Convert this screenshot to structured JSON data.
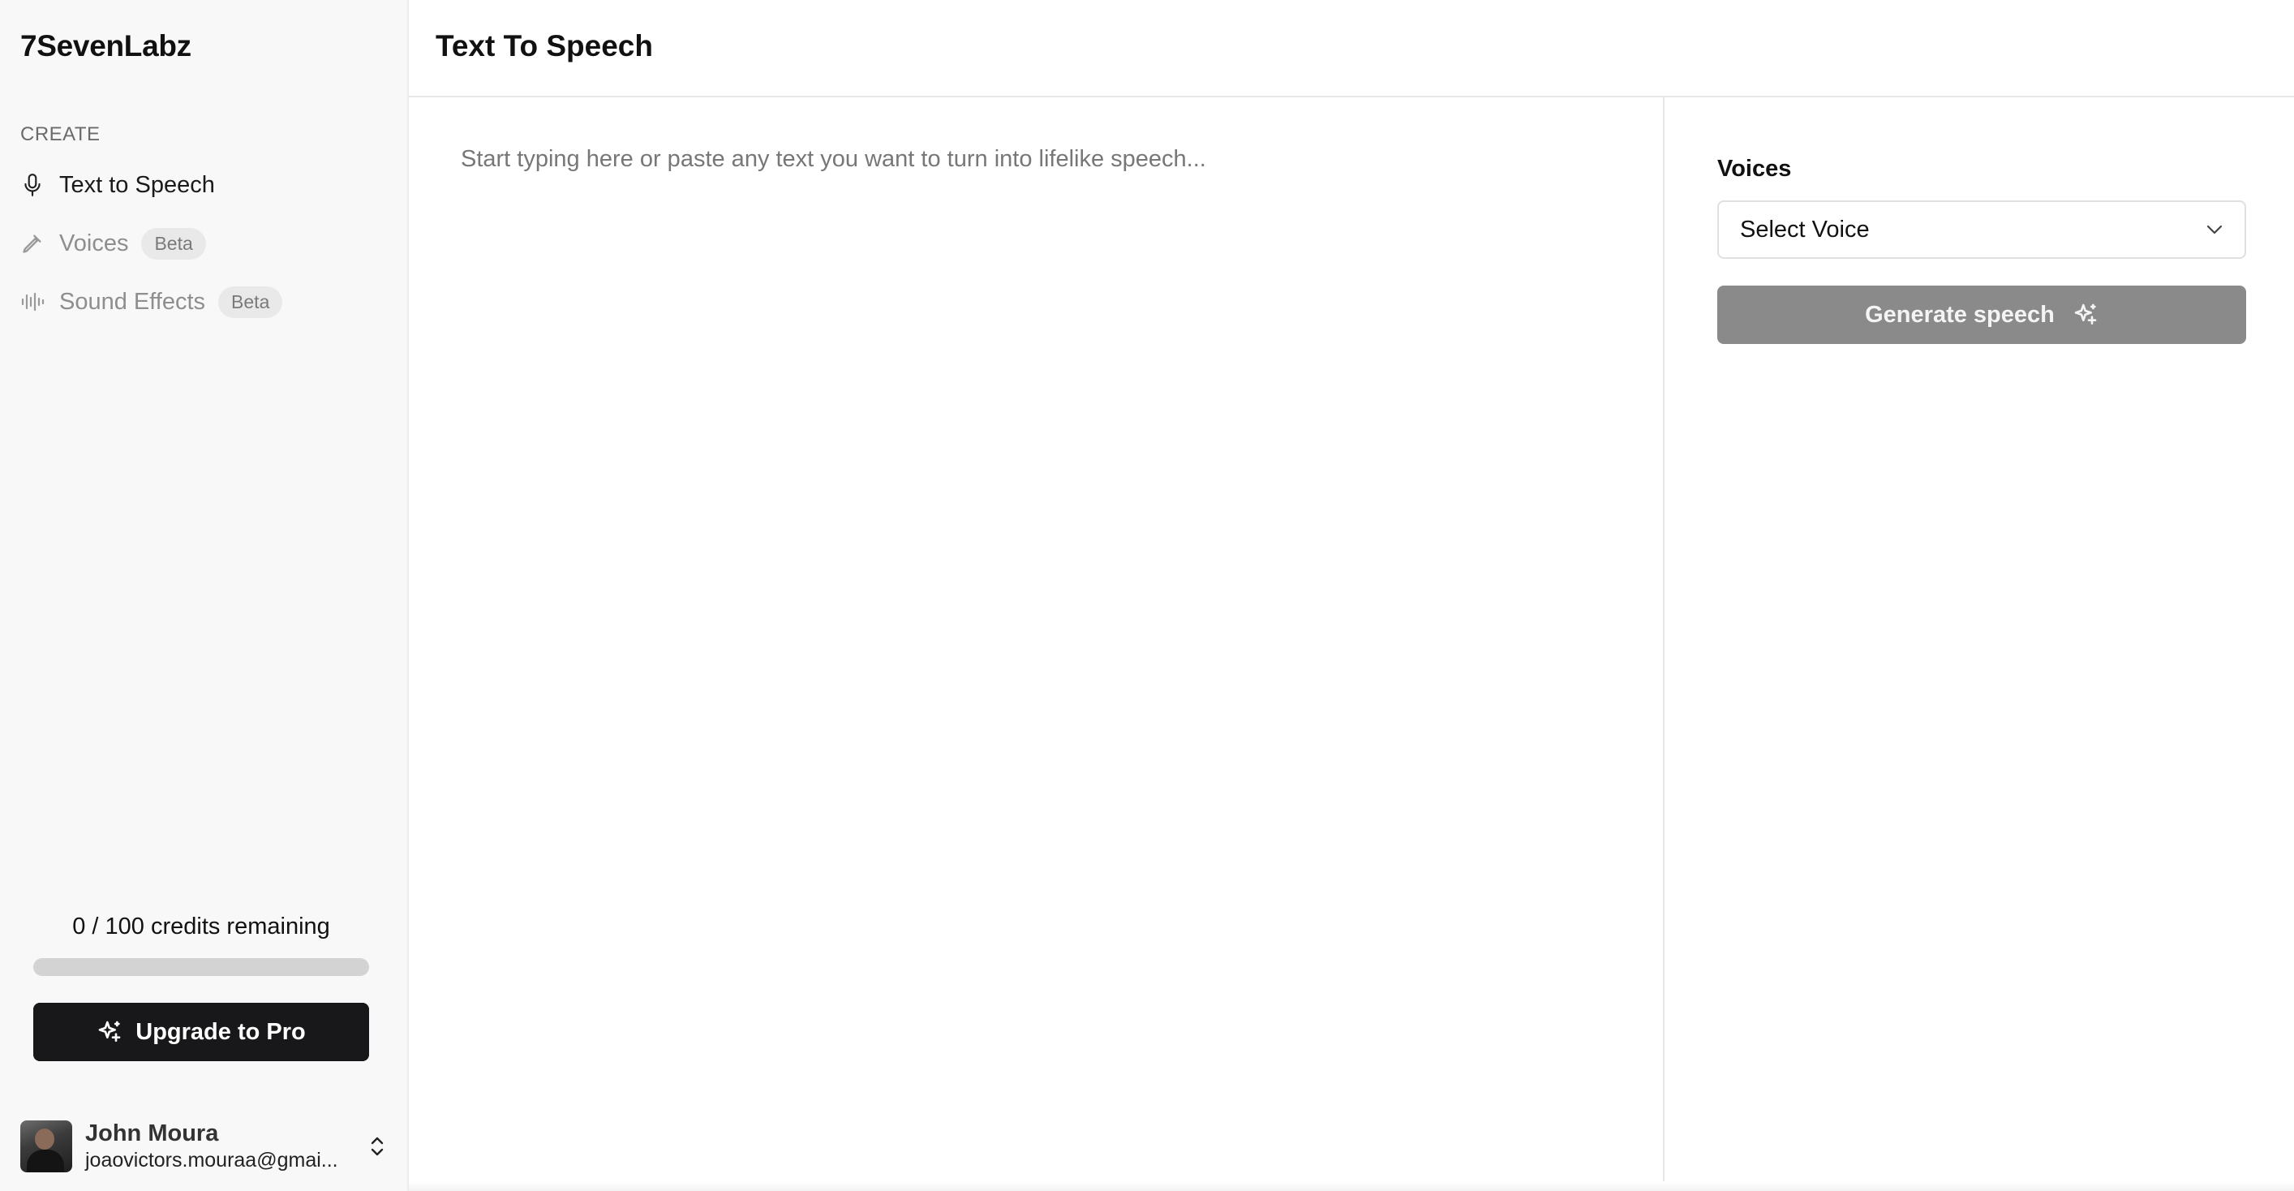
{
  "brand": {
    "name": "7SevenLabz"
  },
  "sidebar": {
    "section_label": "CREATE",
    "items": [
      {
        "label": "Text to Speech",
        "icon": "microphone-icon",
        "active": true
      },
      {
        "label": "Voices",
        "icon": "pen-icon",
        "badge": "Beta",
        "active": false
      },
      {
        "label": "Sound Effects",
        "icon": "waveform-icon",
        "badge": "Beta",
        "active": false
      }
    ],
    "credits": {
      "text": "0 / 100 credits remaining",
      "used": 0,
      "total": 100
    },
    "upgrade_label": "Upgrade to Pro",
    "user": {
      "name": "John Moura",
      "email": "joaovictors.mouraa@gmai..."
    }
  },
  "header": {
    "title": "Text To Speech"
  },
  "editor": {
    "placeholder": "Start typing here or paste any text you want to turn into lifelike speech...",
    "value": ""
  },
  "panel": {
    "voices_label": "Voices",
    "select_value": "Select Voice",
    "generate_label": "Generate speech"
  },
  "colors": {
    "sidebar_bg": "#f8f8f8",
    "upgrade_bg": "#18181a",
    "generate_disabled_bg": "#8a8a8a",
    "badge_bg": "#e9e9e9"
  }
}
